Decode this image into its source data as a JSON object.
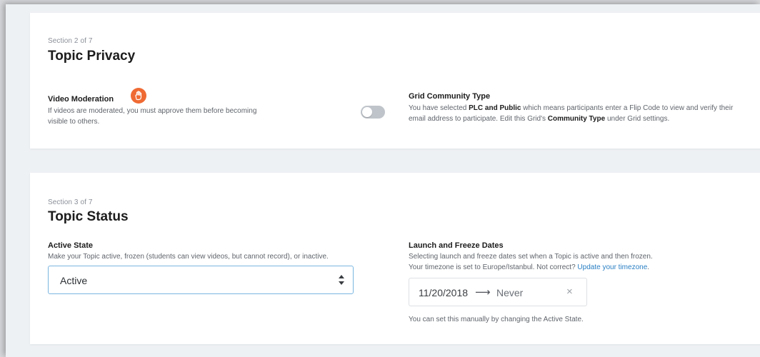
{
  "privacy": {
    "section_label": "Section 2 of 7",
    "title": "Topic Privacy",
    "video_moderation": {
      "label": "Video Moderation",
      "icon": "hand-stop-icon",
      "icon_color": "#ef6a33",
      "description": "If videos are moderated, you must approve them before becoming visible to others.",
      "toggle_on": false
    },
    "community_type": {
      "label": "Grid Community Type",
      "desc_1": "You have selected ",
      "desc_bold_1": "PLC and Public",
      "desc_2": " which means participants enter a Flip Code to view and verify their email address to participate. Edit this Grid's ",
      "desc_bold_2": "Community Type",
      "desc_3": " under Grid settings."
    }
  },
  "status": {
    "section_label": "Section 3 of 7",
    "title": "Topic Status",
    "active_state": {
      "label": "Active State",
      "description": "Make your Topic active, frozen (students can view videos, but cannot record), or inactive.",
      "selected_value": "Active"
    },
    "launch_freeze": {
      "label": "Launch and Freeze Dates",
      "desc_line_1": "Selecting launch and freeze dates set when a Topic is active and then frozen.",
      "desc_line_2": "Your timezone is set to Europe/Istanbul. Not correct? ",
      "timezone_link": "Update your timezone",
      "desc_line_2_end": ".",
      "launch_date": "11/20/2018",
      "arrow": "⟶",
      "freeze_date": "Never",
      "clear": "×",
      "note": "You can set this manually by changing the Active State."
    }
  },
  "colors": {
    "accent_orange": "#ef6a33",
    "link_blue": "#2a7fc4",
    "select_border": "#7bb6e0",
    "toggle_off": "#bfc4ca"
  }
}
